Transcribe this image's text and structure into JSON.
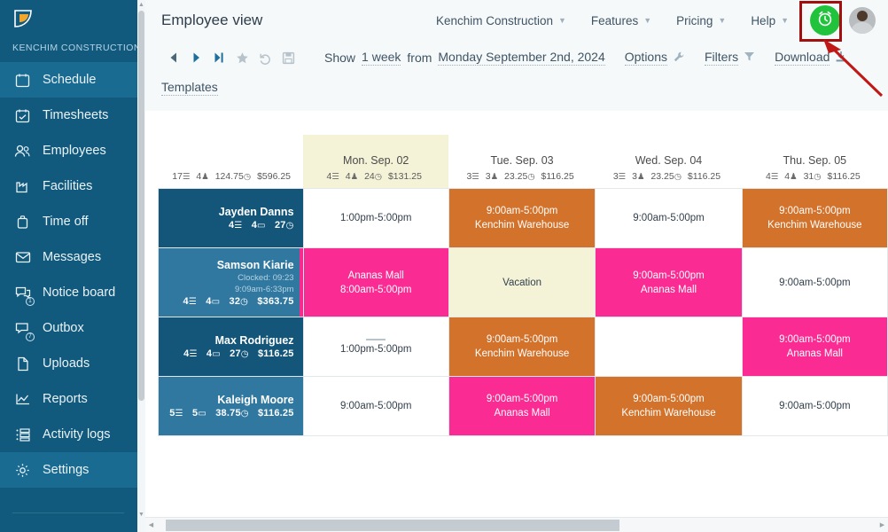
{
  "sidebar": {
    "org_name": "KENCHIM CONSTRUCTION",
    "logo_icon": "leaf-logo-icon",
    "items": [
      {
        "label": "Schedule",
        "icon": "calendar-icon",
        "badge": "",
        "active": true
      },
      {
        "label": "Timesheets",
        "icon": "calendar-check-icon",
        "badge": "",
        "active": false
      },
      {
        "label": "Employees",
        "icon": "users-icon",
        "badge": "",
        "active": false
      },
      {
        "label": "Facilities",
        "icon": "factory-icon",
        "badge": "",
        "active": false
      },
      {
        "label": "Time off",
        "icon": "briefcase-icon",
        "badge": "",
        "active": false
      },
      {
        "label": "Messages",
        "icon": "envelope-icon",
        "badge": "",
        "active": false
      },
      {
        "label": "Notice board",
        "icon": "chat-bubbles-icon",
        "badge": "1",
        "active": false
      },
      {
        "label": "Outbox",
        "icon": "outbox-icon",
        "badge": "7",
        "active": false
      },
      {
        "label": "Uploads",
        "icon": "file-icon",
        "badge": "",
        "active": false
      },
      {
        "label": "Reports",
        "icon": "line-chart-icon",
        "badge": "",
        "active": false
      },
      {
        "label": "Activity logs",
        "icon": "list-icon",
        "badge": "",
        "active": false
      },
      {
        "label": "Settings",
        "icon": "gear-icon",
        "badge": "",
        "active": true
      }
    ]
  },
  "header": {
    "view_title": "Employee view",
    "nav": [
      {
        "label": "Kenchim Construction",
        "has_caret": true
      },
      {
        "label": "Features",
        "has_caret": true
      },
      {
        "label": "Pricing",
        "has_caret": true
      },
      {
        "label": "Help",
        "has_caret": true
      }
    ],
    "clock_button_icon": "alarm-clock-icon",
    "clock_button_color": "#22c33c",
    "avatar_icon": "user-avatar",
    "highlight_color": "#a30e0e"
  },
  "toolbar": {
    "nav_icons": [
      "prev-arrow-icon",
      "next-arrow-icon",
      "skip-to-end-icon",
      "star-icon",
      "undo-icon",
      "save-icon"
    ],
    "show_label": "Show",
    "range_value": "1 week",
    "from_label": "from",
    "from_date": "Monday September 2nd, 2024",
    "options_label": "Options",
    "options_icon": "wrench-icon",
    "filters_label": "Filters",
    "filters_icon": "funnel-icon",
    "download_label": "Download",
    "download_icon": "download-icon",
    "templates_label": "Templates"
  },
  "grid": {
    "totals": {
      "shifts": "17",
      "employees": "4",
      "hours": "124.75",
      "cost": "$596.25"
    },
    "days": [
      {
        "date": "Mon. Sep. 02",
        "shifts": "4",
        "employees": "4",
        "hours": "24",
        "cost": "$131.25",
        "today": true
      },
      {
        "date": "Tue. Sep. 03",
        "shifts": "3",
        "employees": "3",
        "hours": "23.25",
        "cost": "$116.25",
        "today": false
      },
      {
        "date": "Wed. Sep. 04",
        "shifts": "3",
        "employees": "3",
        "hours": "23.25",
        "cost": "$116.25",
        "today": false
      },
      {
        "date": "Thu. Sep. 05",
        "shifts": "4",
        "employees": "4",
        "hours": "31",
        "cost": "$116.25",
        "today": false
      }
    ],
    "rows": [
      {
        "name": "Jayden Danns",
        "clocked": "",
        "clocked_range": "",
        "stats": {
          "shifts": "4",
          "days": "4",
          "hours": "27",
          "cost": ""
        },
        "shade": "dark",
        "edge": false,
        "cells": [
          {
            "time": "1:00pm-5:00pm",
            "location": "",
            "style": "plain",
            "dash": false
          },
          {
            "time": "9:00am-5:00pm",
            "location": "Kenchim Warehouse",
            "style": "orange",
            "dash": false
          },
          {
            "time": "9:00am-5:00pm",
            "location": "",
            "style": "plain",
            "dash": false
          },
          {
            "time": "9:00am-5:00pm",
            "location": "Kenchim Warehouse",
            "style": "orange",
            "dash": false
          }
        ]
      },
      {
        "name": "Samson Kiarie",
        "clocked": "Clocked: 09:23",
        "clocked_range": "9:09am-6:33pm",
        "stats": {
          "shifts": "4",
          "days": "4",
          "hours": "32",
          "cost": "$363.75"
        },
        "shade": "light",
        "edge": true,
        "cells": [
          {
            "time": "8:00am-5:00pm",
            "location": "Ananas Mall",
            "style": "pink",
            "location_first": true,
            "dash": false
          },
          {
            "time": "",
            "location": "Vacation",
            "style": "cream",
            "dash": false
          },
          {
            "time": "9:00am-5:00pm",
            "location": "Ananas Mall",
            "style": "pink",
            "dash": false
          },
          {
            "time": "9:00am-5:00pm",
            "location": "",
            "style": "plain",
            "dash": false
          }
        ]
      },
      {
        "name": "Max Rodriguez",
        "clocked": "",
        "clocked_range": "",
        "stats": {
          "shifts": "4",
          "days": "4",
          "hours": "27",
          "cost": "$116.25"
        },
        "shade": "dark",
        "edge": false,
        "cells": [
          {
            "time": "1:00pm-5:00pm",
            "location": "",
            "style": "plain",
            "dash": true
          },
          {
            "time": "9:00am-5:00pm",
            "location": "Kenchim Warehouse",
            "style": "orange",
            "dash": false
          },
          {
            "time": "",
            "location": "",
            "style": "plain",
            "dash": false
          },
          {
            "time": "9:00am-5:00pm",
            "location": "Ananas Mall",
            "style": "pink",
            "dash": false
          }
        ]
      },
      {
        "name": "Kaleigh Moore",
        "clocked": "",
        "clocked_range": "",
        "stats": {
          "shifts": "5",
          "days": "5",
          "hours": "38.75",
          "cost": "$116.25"
        },
        "shade": "light",
        "edge": false,
        "cells": [
          {
            "time": "9:00am-5:00pm",
            "location": "",
            "style": "plain",
            "dash": false
          },
          {
            "time": "9:00am-5:00pm",
            "location": "Ananas Mall",
            "style": "pink",
            "dash": false
          },
          {
            "time": "9:00am-5:00pm",
            "location": "Kenchim Warehouse",
            "style": "orange",
            "dash": false
          },
          {
            "time": "9:00am-5:00pm",
            "location": "",
            "style": "plain",
            "dash": false
          }
        ]
      }
    ]
  }
}
